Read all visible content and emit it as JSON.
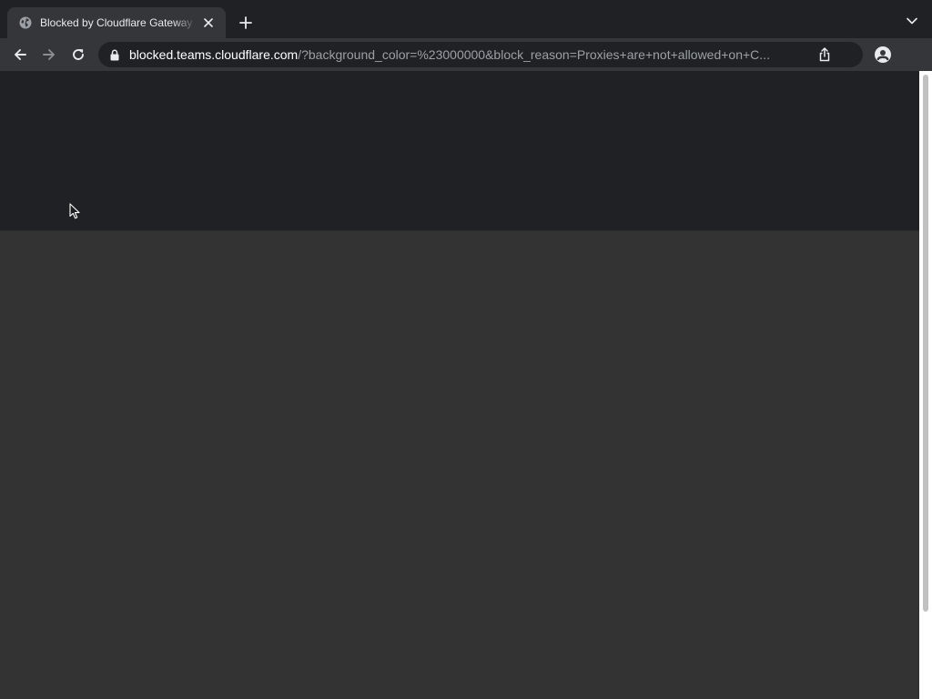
{
  "browser": {
    "tab": {
      "title": "Blocked by Cloudflare Gateway",
      "favicon": "globe-icon"
    },
    "new_tab_icon": "plus-icon",
    "tab_search_icon": "chevron-down-icon",
    "toolbar": {
      "back_icon": "arrow-left-icon",
      "forward_icon": "arrow-right-icon",
      "reload_icon": "reload-icon",
      "profile_icon": "person-icon",
      "share_icon": "share-icon"
    },
    "omnibox": {
      "lock_icon": "lock-icon",
      "url_host": "blocked.teams.cloudflare.com",
      "url_rest": "/?background_color=%23000000&block_reason=Proxies+are+not+allowed+on+C..."
    }
  },
  "colors": {
    "tabstrip_bg": "#202124",
    "toolbar_bg": "#35363a",
    "page_header_bg": "#202124",
    "page_body_bg": "#333333"
  }
}
